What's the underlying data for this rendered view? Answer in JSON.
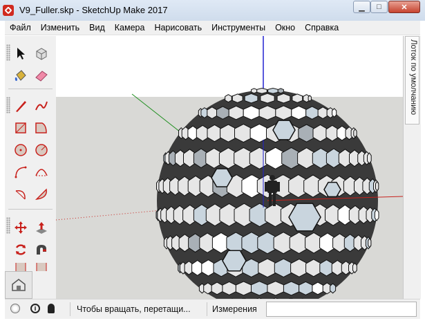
{
  "window": {
    "title": "V9_Fuller.skp - SketchUp Make 2017",
    "icon": "sketchup-app-icon",
    "controls": [
      "minimize",
      "maximize",
      "close"
    ]
  },
  "menu": [
    "Файл",
    "Изменить",
    "Вид",
    "Камера",
    "Нарисовать",
    "Инструменты",
    "Окно",
    "Справка"
  ],
  "toolbar": {
    "tools": [
      "select-arrow-icon",
      "make-component-icon",
      "paint-bucket-icon",
      "eraser-icon",
      "line-pencil-icon",
      "freehand-icon",
      "rectangle-icon",
      "rotated-rectangle-icon",
      "circle-icon",
      "polygon-icon",
      "arc-icon",
      "two-point-arc-icon",
      "three-point-arc-icon",
      "pie-icon",
      "move-icon",
      "push-pull-icon",
      "rotate-icon",
      "follow-me-icon",
      "scale-icon",
      "offset-icon"
    ],
    "warehouse_icon": "3d-warehouse-icon"
  },
  "tray": {
    "label": "Лоток по умолчанию"
  },
  "status": {
    "hint": "Чтобы вращать, перетащи...",
    "measurements_label": "Измерения",
    "measurements_value": ""
  },
  "colors": {
    "axis_red": "#c8211c",
    "axis_green": "#1f8f1f",
    "axis_blue": "#2020d0",
    "sky": "#ffffff",
    "ground": "#d9d9d6",
    "sphere_face": "#e6e6e6",
    "sphere_face_accent": "#c9d5de"
  }
}
